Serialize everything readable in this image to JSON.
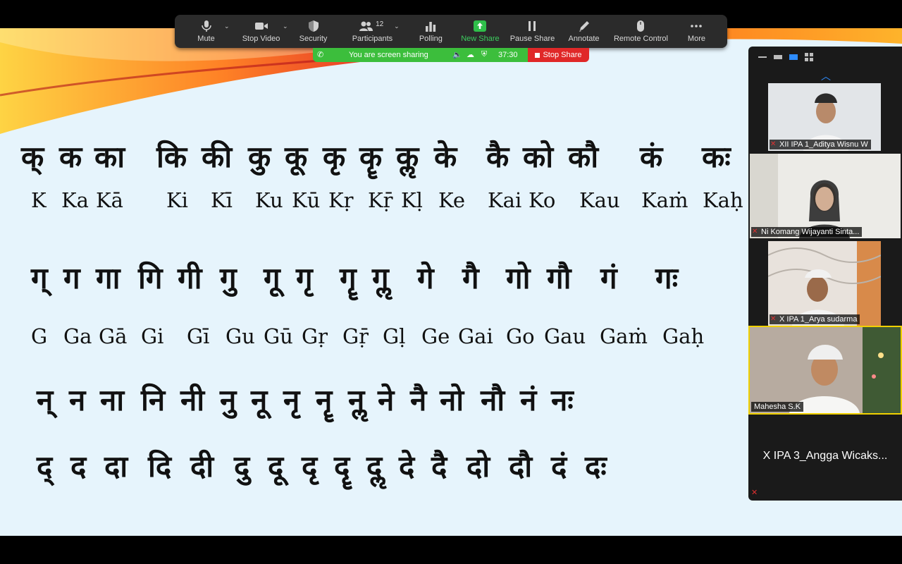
{
  "toolbar": {
    "mute": "Mute",
    "stop_video": "Stop Video",
    "security": "Security",
    "participants": "Participants",
    "participants_count": "12",
    "polling": "Polling",
    "new_share": "New Share",
    "pause_share": "Pause Share",
    "annotate": "Annotate",
    "remote_control": "Remote Control",
    "more": "More"
  },
  "share_status": {
    "message": "You are screen sharing",
    "timer": "37:30",
    "stop_label": "Stop Share"
  },
  "slide": {
    "row1_deva": [
      "क्",
      "क",
      "का",
      "कि",
      "की",
      "कु",
      "कू",
      "कृ",
      "कॄ",
      "कॢ",
      "के",
      "कै",
      "को",
      "कौ",
      "कं",
      "कः"
    ],
    "row1_latin": [
      "K",
      "Ka",
      "Kā",
      "Ki",
      "Kī",
      "Ku",
      "Kū",
      "Kṛ",
      "Kṝ",
      "Kḷ",
      "Ke",
      "Kai",
      "Ko",
      "Kau",
      "Kaṁ",
      "Kaḥ"
    ],
    "row2_deva": [
      "ग्",
      "ग",
      "गा",
      "गि",
      "गी",
      "गु",
      "गू",
      "गृ",
      "गॄ",
      "गॢ",
      "गे",
      "गै",
      "गो",
      "गौ",
      "गं",
      "गः"
    ],
    "row2_latin": [
      "G",
      "Ga",
      "Gā",
      "Gi",
      "Gī",
      "Gu",
      "Gū",
      "Gṛ",
      "Gṝ",
      "Gḷ",
      "Ge",
      "Gai",
      "Go",
      "Gau",
      "Gaṁ",
      "Gaḥ"
    ],
    "row3_deva": [
      "न्",
      "न",
      "ना",
      "नि",
      "नी",
      "नु",
      "नू",
      "नृ",
      "नॄ",
      "नॢ",
      "ने",
      "नै",
      "नो",
      "नौ",
      "नं",
      "नः"
    ],
    "row4_deva": [
      "द्",
      "द",
      "दा",
      "दि",
      "दी",
      "दु",
      "दू",
      "दृ",
      "दॄ",
      "दॢ",
      "दे",
      "दै",
      "दो",
      "दौ",
      "दं",
      "दः"
    ]
  },
  "gallery": {
    "participants": [
      {
        "name": "XII IPA 1_Aditya Wisnu W",
        "muted": true
      },
      {
        "name": "Ni Komang Wijayanti Sinta...",
        "muted": true
      },
      {
        "name": "X IPA 1_Arya sudarma",
        "muted": true
      },
      {
        "name": "Mahesha S.K",
        "muted": false
      },
      {
        "name": "X IPA 3_Angga Wicaks...",
        "muted": true
      }
    ]
  }
}
